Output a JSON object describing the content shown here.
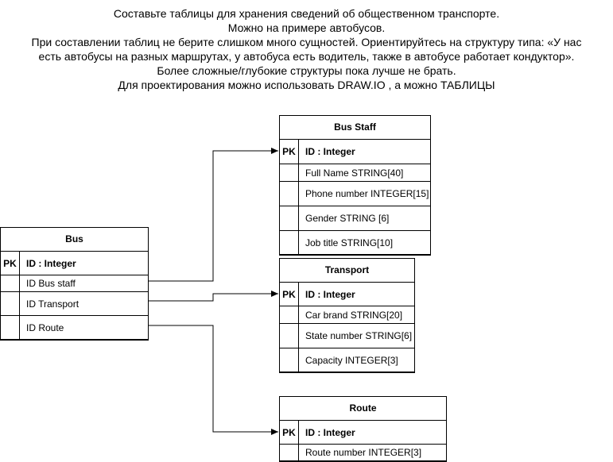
{
  "intro": {
    "lines": [
      "Составьте таблицы для хранения сведений об общественном транспорте.",
      "Можно на примере автобусов.",
      "При составлении таблиц не берите слишком много сущностей. Ориентируйтесь на структуру типа: «У нас",
      "есть автобусы на разных маршрутах, у автобуса есть водитель, также в автобусе работает кондуктор».",
      "Более сложные/глубокие структуры пока лучше не брать.",
      "Для проектирования можно использовать DRAW.IO , а можно ТАБЛИЦЫ"
    ]
  },
  "tables": {
    "bus": {
      "title": "Bus",
      "pk_label": "PK",
      "pk_field": "ID : Integer",
      "fields": [
        "ID Bus staff",
        "ID Transport",
        "ID Route"
      ]
    },
    "bus_staff": {
      "title": "Bus Staff",
      "pk_label": "PK",
      "pk_field": "ID : Integer",
      "fields": [
        "Full Name STRING[40]",
        "Phone number INTEGER[15]",
        "Gender STRING [6]",
        "Job title STRING[10]"
      ]
    },
    "transport": {
      "title": "Transport",
      "pk_label": "PK",
      "pk_field": "ID : Integer",
      "fields": [
        "Car brand STRING[20]",
        "State number STRING[6]",
        "Capacity INTEGER[3]"
      ]
    },
    "route": {
      "title": "Route",
      "pk_label": "PK",
      "pk_field": "ID : Integer",
      "fields": [
        "Route number INTEGER[3]"
      ]
    }
  },
  "colors": {
    "line": "#000000",
    "background": "#ffffff"
  }
}
